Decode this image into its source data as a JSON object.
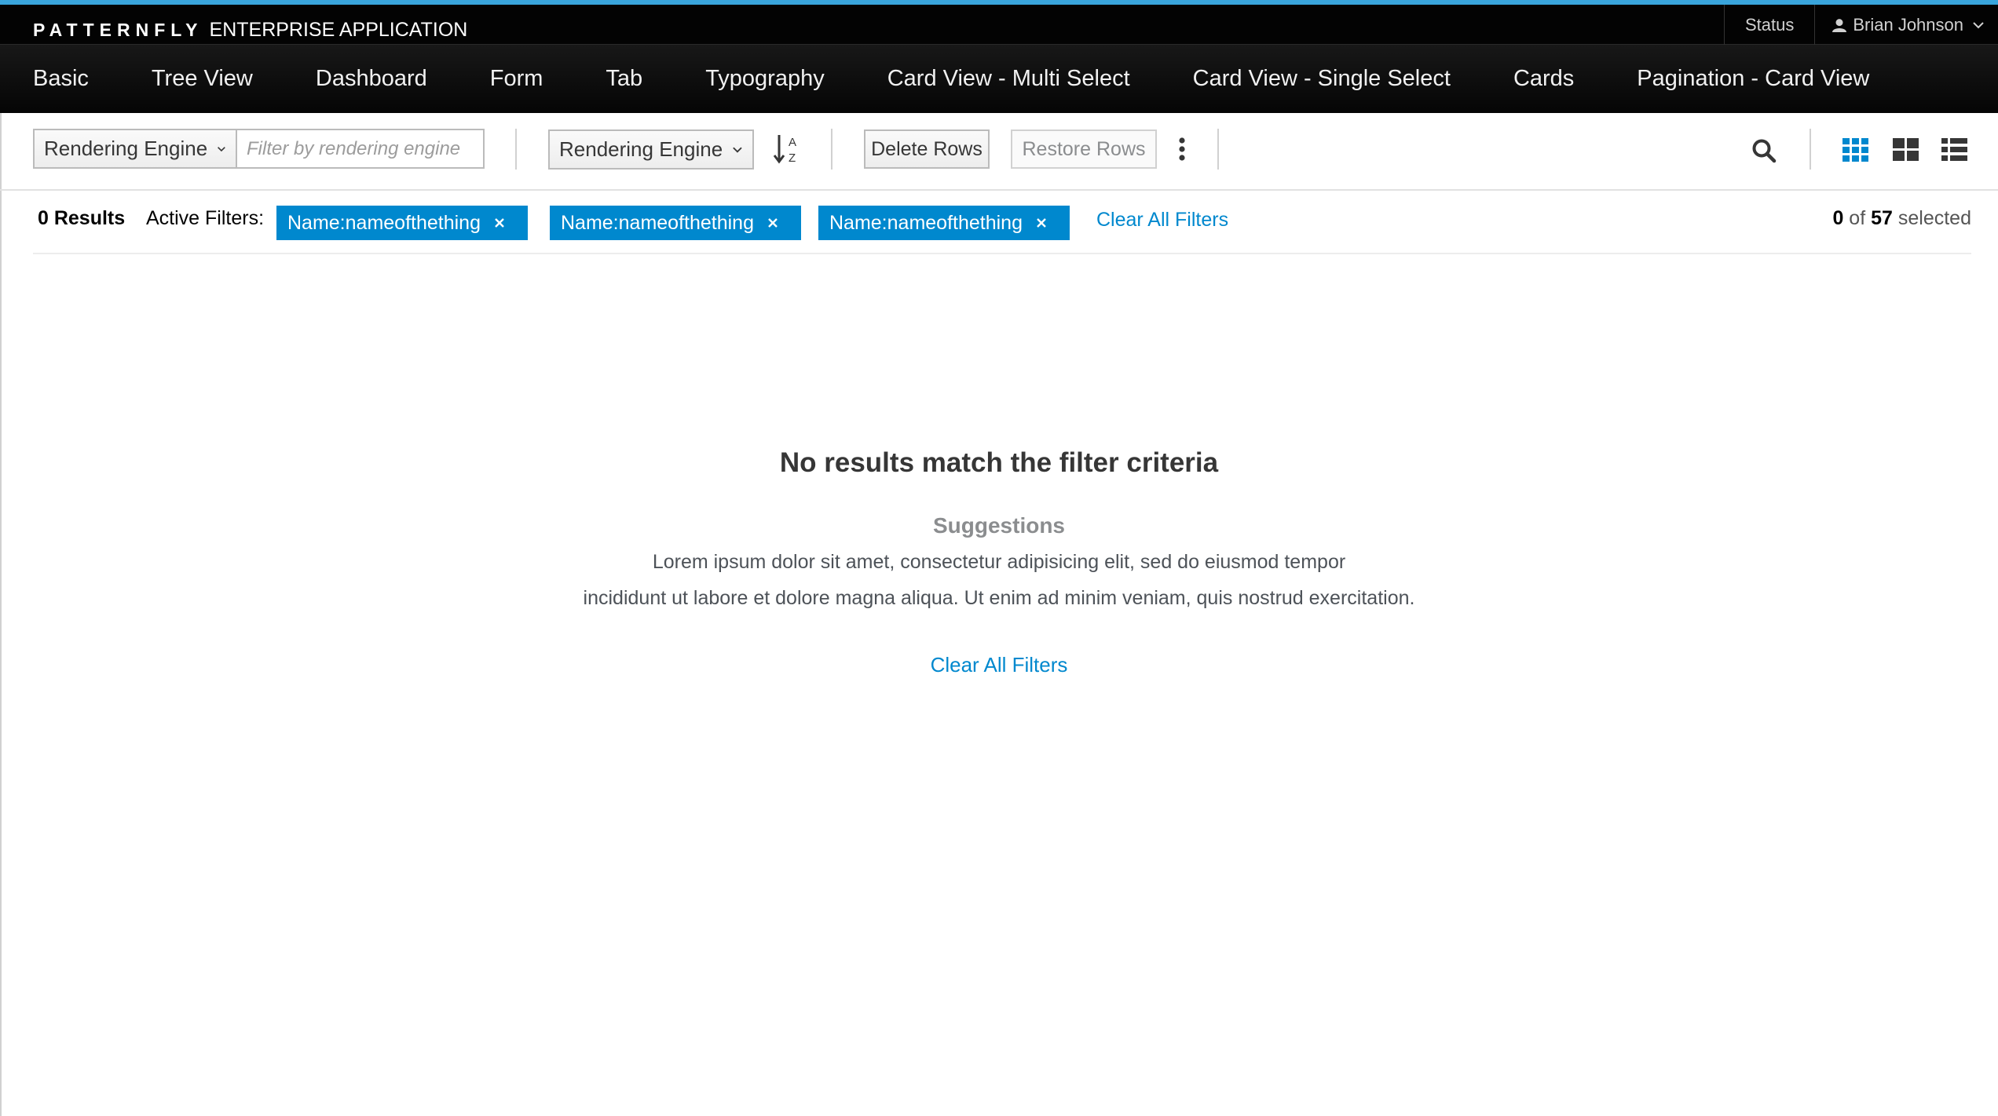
{
  "masthead": {
    "brand_name": "PATTERNFLY",
    "brand_subtitle": "ENTERPRISE APPLICATION",
    "status_label": "Status",
    "user_name": "Brian Johnson",
    "accent_color": "#39a5dc"
  },
  "nav": {
    "items": [
      {
        "label": "Basic"
      },
      {
        "label": "Tree View"
      },
      {
        "label": "Dashboard"
      },
      {
        "label": "Form"
      },
      {
        "label": "Tab"
      },
      {
        "label": "Typography"
      },
      {
        "label": "Card View - Multi Select"
      },
      {
        "label": "Card View - Single Select"
      },
      {
        "label": "Cards"
      },
      {
        "label": "Pagination - Card View"
      }
    ]
  },
  "toolbar": {
    "filter_field_label": "Rendering Engine",
    "filter_placeholder": "Filter by rendering engine",
    "sort_field_label": "Rendering Engine",
    "sort_icon": "sort-alpha-asc-icon",
    "delete_label": "Delete Rows",
    "restore_label": "Restore Rows",
    "kebab_icon": "kebab-icon",
    "search_icon": "search-icon",
    "views": [
      {
        "icon": "small-card-view-icon",
        "active": true
      },
      {
        "icon": "large-card-view-icon",
        "active": false
      },
      {
        "icon": "list-view-icon",
        "active": false
      }
    ]
  },
  "results": {
    "count_label": "0 Results",
    "active_filters_label": "Active Filters:",
    "chips": [
      {
        "label": "Name:nameofthething"
      },
      {
        "label": "Name:nameofthething"
      },
      {
        "label": "Name:nameofthething"
      }
    ],
    "clear_all_label": "Clear All Filters",
    "selected_count": "0",
    "selected_of": "of",
    "selected_total": "57",
    "selected_suffix": "selected"
  },
  "empty_state": {
    "title": "No results match the filter criteria",
    "suggestions_label": "Suggestions",
    "line1": "Lorem ipsum dolor sit amet, consectetur adipisicing elit, sed do eiusmod tempor",
    "line2": "incididunt ut labore et dolore magna aliqua. Ut enim ad minim veniam, quis nostrud exercitation.",
    "clear_all_label": "Clear All Filters"
  },
  "colors": {
    "chip_bg": "#0088ce",
    "link": "#0088ce",
    "active_view": "#0088ce"
  }
}
